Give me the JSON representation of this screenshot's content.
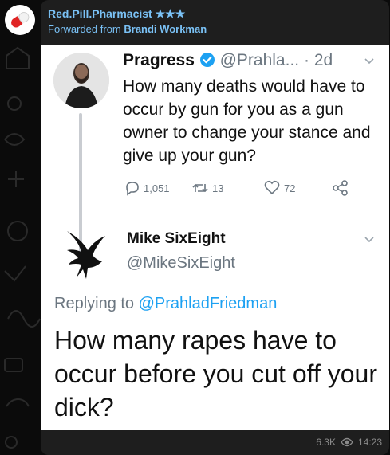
{
  "post": {
    "channel_name": "Red.Pill.Pharmacist",
    "channel_stars": "★★★",
    "forwarded_prefix": "Forwarded from",
    "forwarded_from": "Brandi Workman",
    "views": "6.3K",
    "time": "14:23",
    "icons": {
      "views": "eye-icon",
      "avatar": "pill-icon"
    }
  },
  "tweet1": {
    "author_name": "Pragress",
    "handle": "@Prahla...",
    "dot": "·",
    "age": "2d",
    "text": "How many deaths would have to occur by gun for you as a gun owner to change your stance and give up your gun?",
    "replies": "1,051",
    "retweets": "13",
    "likes": "72"
  },
  "tweet2": {
    "author_name": "Mike SixEight",
    "handle": "@MikeSixEight",
    "replying_prefix": "Replying to",
    "replying_to": "@PrahladFriedman",
    "text": "How many rapes have to occur before you cut off your dick?"
  },
  "colors": {
    "accent": "#7ac1f5",
    "mention": "#1da1f2",
    "muted": "#6b7680",
    "bubble": "#1e1e1e"
  }
}
